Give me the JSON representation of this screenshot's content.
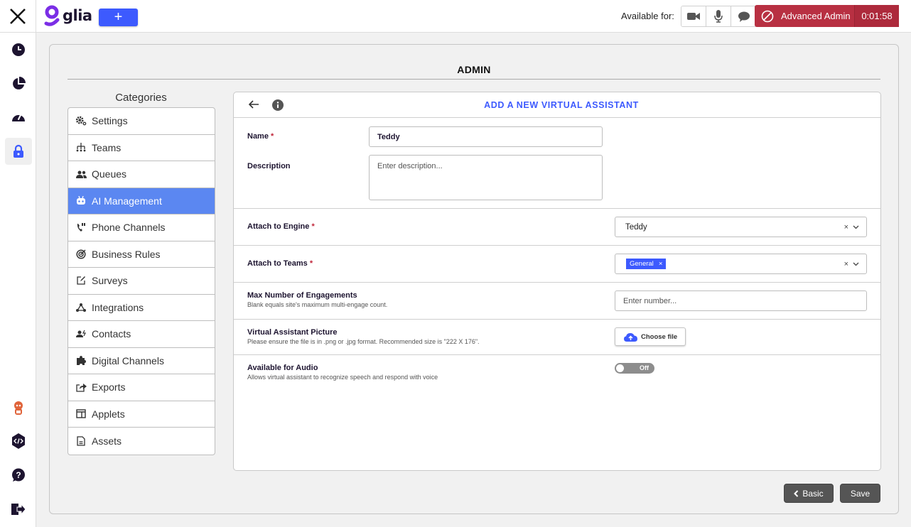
{
  "topbar": {
    "logo_text": "glia",
    "add_label": "+",
    "available_for_label": "Available for:",
    "availability_buttons": [
      {
        "name": "video",
        "icon": "video-camera-icon"
      },
      {
        "name": "audio",
        "icon": "microphone-icon"
      },
      {
        "name": "chat",
        "icon": "chat-bubble-icon"
      }
    ],
    "status": {
      "label": "Advanced Admin",
      "timer": "0:01:58",
      "icon": "blocked-icon",
      "color": "#b83042"
    }
  },
  "rail": {
    "top_items": [
      {
        "name": "history",
        "icon": "clock-icon"
      },
      {
        "name": "reports",
        "icon": "pie-chart-icon"
      },
      {
        "name": "dashboard",
        "icon": "gauge-icon"
      },
      {
        "name": "admin",
        "icon": "lock-icon",
        "active": true
      }
    ],
    "bottom_items": [
      {
        "name": "profile",
        "icon": "avatar-icon"
      },
      {
        "name": "developer",
        "icon": "code-icon"
      },
      {
        "name": "help",
        "icon": "help-icon"
      },
      {
        "name": "sign-out",
        "icon": "sign-out-icon"
      }
    ]
  },
  "admin": {
    "title": "ADMIN",
    "categories_title": "Categories",
    "categories": [
      {
        "label": "Settings",
        "icon": "gears-icon"
      },
      {
        "label": "Teams",
        "icon": "org-chart-icon"
      },
      {
        "label": "Queues",
        "icon": "users-icon"
      },
      {
        "label": "AI Management",
        "icon": "robot-icon",
        "active": true
      },
      {
        "label": "Phone Channels",
        "icon": "phone-icon"
      },
      {
        "label": "Business Rules",
        "icon": "target-icon"
      },
      {
        "label": "Surveys",
        "icon": "edit-icon"
      },
      {
        "label": "Integrations",
        "icon": "network-icon"
      },
      {
        "label": "Contacts",
        "icon": "contacts-icon"
      },
      {
        "label": "Digital Channels",
        "icon": "puzzle-icon"
      },
      {
        "label": "Exports",
        "icon": "share-icon"
      },
      {
        "label": "Applets",
        "icon": "window-icon"
      },
      {
        "label": "Assets",
        "icon": "file-icon"
      }
    ]
  },
  "form": {
    "title": "ADD A NEW VIRTUAL ASSISTANT",
    "name": {
      "label": "Name",
      "required": "*",
      "value": "Teddy"
    },
    "description": {
      "label": "Description",
      "placeholder": "Enter description..."
    },
    "engine": {
      "label": "Attach to Engine",
      "required": "*",
      "value": "Teddy"
    },
    "teams": {
      "label": "Attach to Teams",
      "required": "*",
      "chips": [
        "General"
      ]
    },
    "max_engagements": {
      "label": "Max Number of Engagements",
      "hint": "Blank equals site's maximum multi-engage count.",
      "placeholder": "Enter number..."
    },
    "picture": {
      "label": "Virtual Assistant Picture",
      "hint": "Please ensure the file is in .png or .jpg format. Recommended size is \"222 X 176\".",
      "button": "Choose file"
    },
    "audio": {
      "label": "Available for Audio",
      "hint": "Allows virtual assistant to recognize speech and respond with voice",
      "toggle": "Off",
      "on": false
    },
    "clear_glyph": "×",
    "chip_remove_glyph": "×"
  },
  "footer": {
    "basic_label": "Basic",
    "save_label": "Save"
  }
}
